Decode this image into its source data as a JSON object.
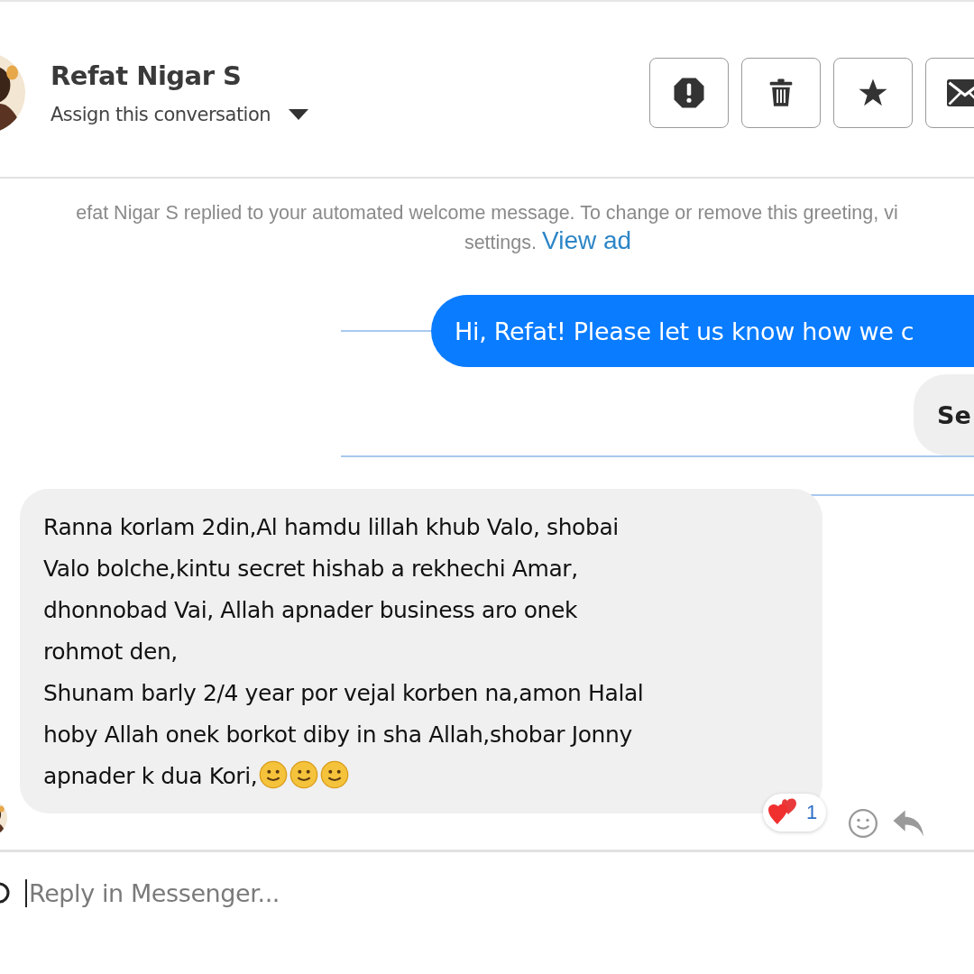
{
  "contact": {
    "name": "Refat Nigar S",
    "assign_label": "Assign this conversation"
  },
  "actions": [
    {
      "kind": "alert"
    },
    {
      "kind": "delete"
    },
    {
      "kind": "star"
    },
    {
      "kind": "mail"
    }
  ],
  "notice": {
    "text": "efat Nigar S replied to your automated welcome message. To change or remove this greeting, vi",
    "text_2": "settings.",
    "link": "View ad"
  },
  "messages": [
    {
      "kind": "sent",
      "text": "Hi, Refat! Please let us know how we c"
    },
    {
      "kind": "quick-reply",
      "text": "Se"
    },
    {
      "kind": "received",
      "lines": [
        "Ranna korlam 2din,Al hamdu lillah khub Valo, shobai",
        "Valo bolche,kintu secret hishab a rekhechi Amar,",
        "dhonnobad Vai, Allah apnader business aro onek",
        "rohmot den,",
        "Shunam barly 2/4 year por vejal korben na,amon Halal",
        "hoby Allah onek borkot diby in sha Allah,shobar Jonny",
        "apnader k dua Kori,"
      ],
      "emojis": [
        {
          "kind": "smile"
        },
        {
          "kind": "smile"
        },
        {
          "kind": "smile"
        }
      ],
      "reaction": {
        "kind": "hearts",
        "count": "1"
      }
    }
  ],
  "composer": {
    "placeholder": "Reply in Messenger..."
  }
}
